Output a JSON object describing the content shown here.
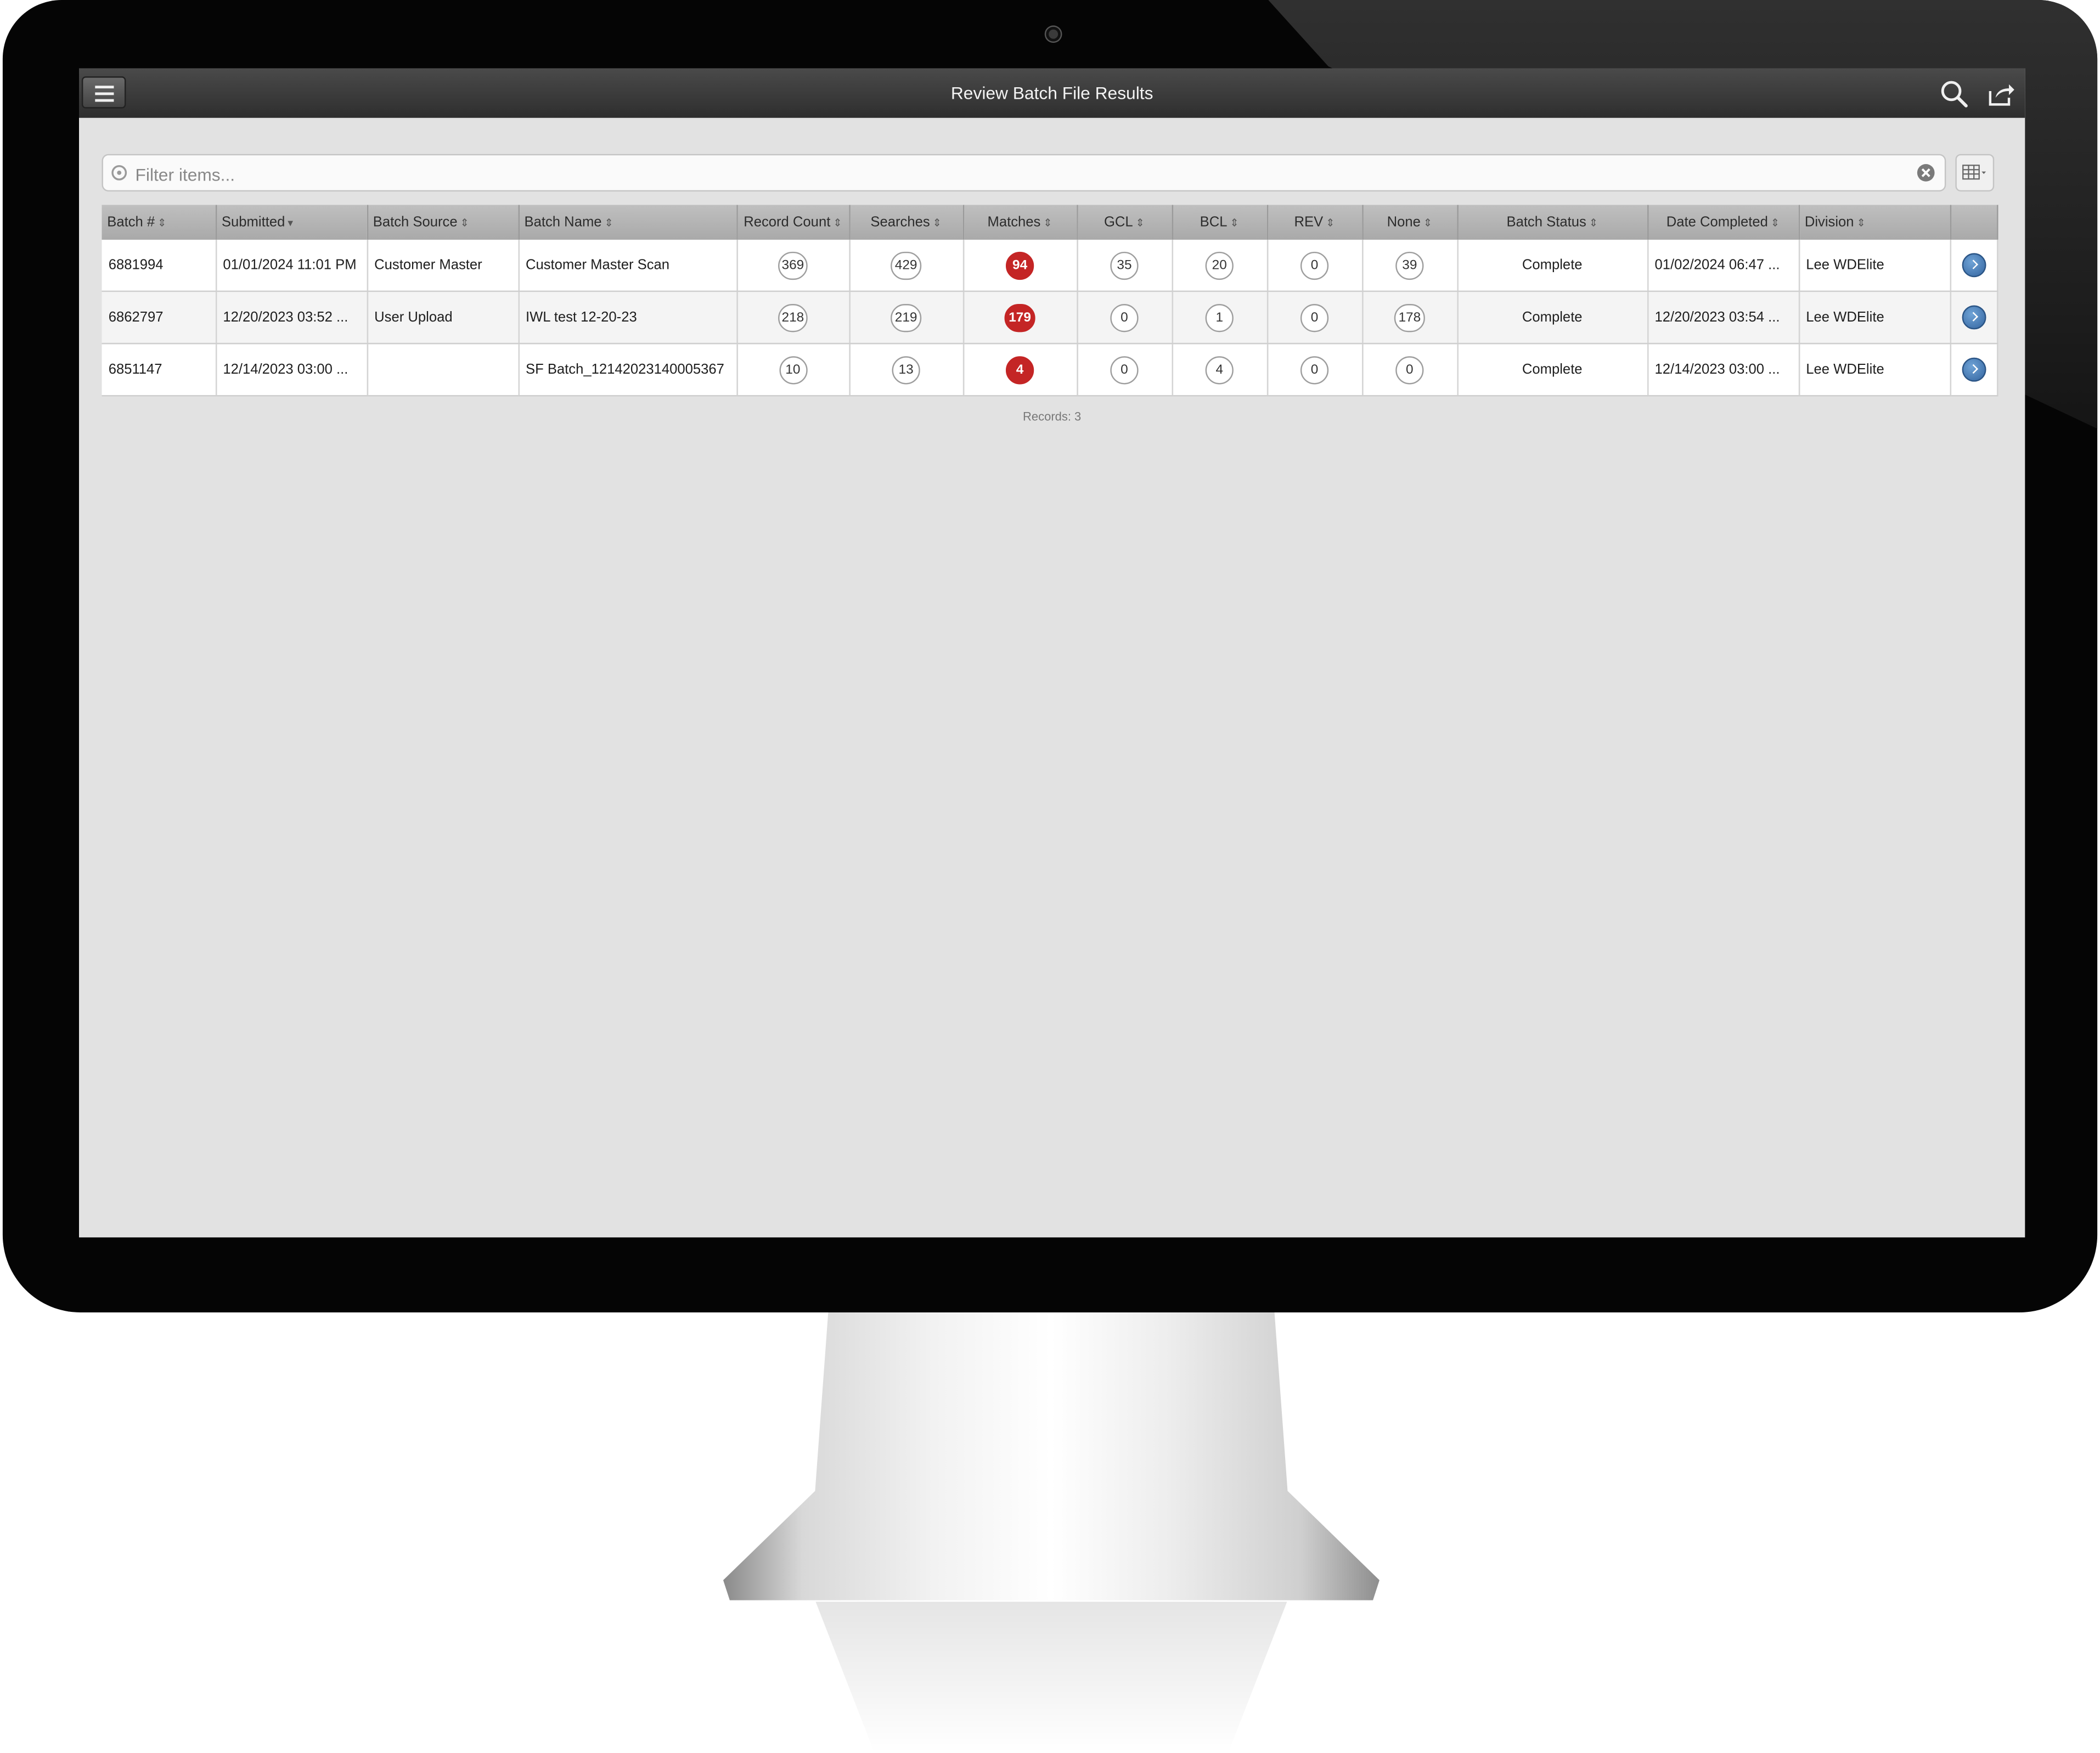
{
  "app": {
    "title": "Review Batch File Results"
  },
  "filter": {
    "placeholder": "Filter items..."
  },
  "icons": {
    "menu": "hamburger-menu-icon",
    "search": "search-icon",
    "share": "share-export-icon",
    "filter_search": "search-icon",
    "clear": "clear-circle-icon",
    "column_chooser": "grid-columns-icon",
    "row_detail": "chevron-right-circle-icon"
  },
  "colors": {
    "matches_badge": "#c42525",
    "detail_button": "#3a6ea8",
    "title_bar": "#333333"
  },
  "table": {
    "columns": [
      "Batch #",
      "Submitted",
      "Batch Source",
      "Batch Name",
      "Record Count",
      "Searches",
      "Matches",
      "GCL",
      "BCL",
      "REV",
      "None",
      "Batch Status",
      "Date Completed",
      "Division"
    ],
    "rows": [
      {
        "batch": "6881994",
        "submitted": "01/01/2024 11:01 PM",
        "source": "Customer Master",
        "name": "Customer Master Scan",
        "record_count": "369",
        "searches": "429",
        "matches": "94",
        "gcl": "35",
        "bcl": "20",
        "rev": "0",
        "none": "39",
        "status": "Complete",
        "completed": "01/02/2024 06:47 ...",
        "division": "Lee WDElite"
      },
      {
        "batch": "6862797",
        "submitted": "12/20/2023 03:52 ...",
        "source": "User Upload",
        "name": "IWL test 12-20-23",
        "record_count": "218",
        "searches": "219",
        "matches": "179",
        "gcl": "0",
        "bcl": "1",
        "rev": "0",
        "none": "178",
        "status": "Complete",
        "completed": "12/20/2023 03:54 ...",
        "division": "Lee WDElite"
      },
      {
        "batch": "6851147",
        "submitted": "12/14/2023 03:00 ...",
        "source": "",
        "name": "SF Batch_12142023140005367",
        "record_count": "10",
        "searches": "13",
        "matches": "4",
        "gcl": "0",
        "bcl": "4",
        "rev": "0",
        "none": "0",
        "status": "Complete",
        "completed": "12/14/2023 03:00 ...",
        "division": "Lee WDElite"
      }
    ]
  },
  "footer": {
    "records": "Records: 3"
  }
}
